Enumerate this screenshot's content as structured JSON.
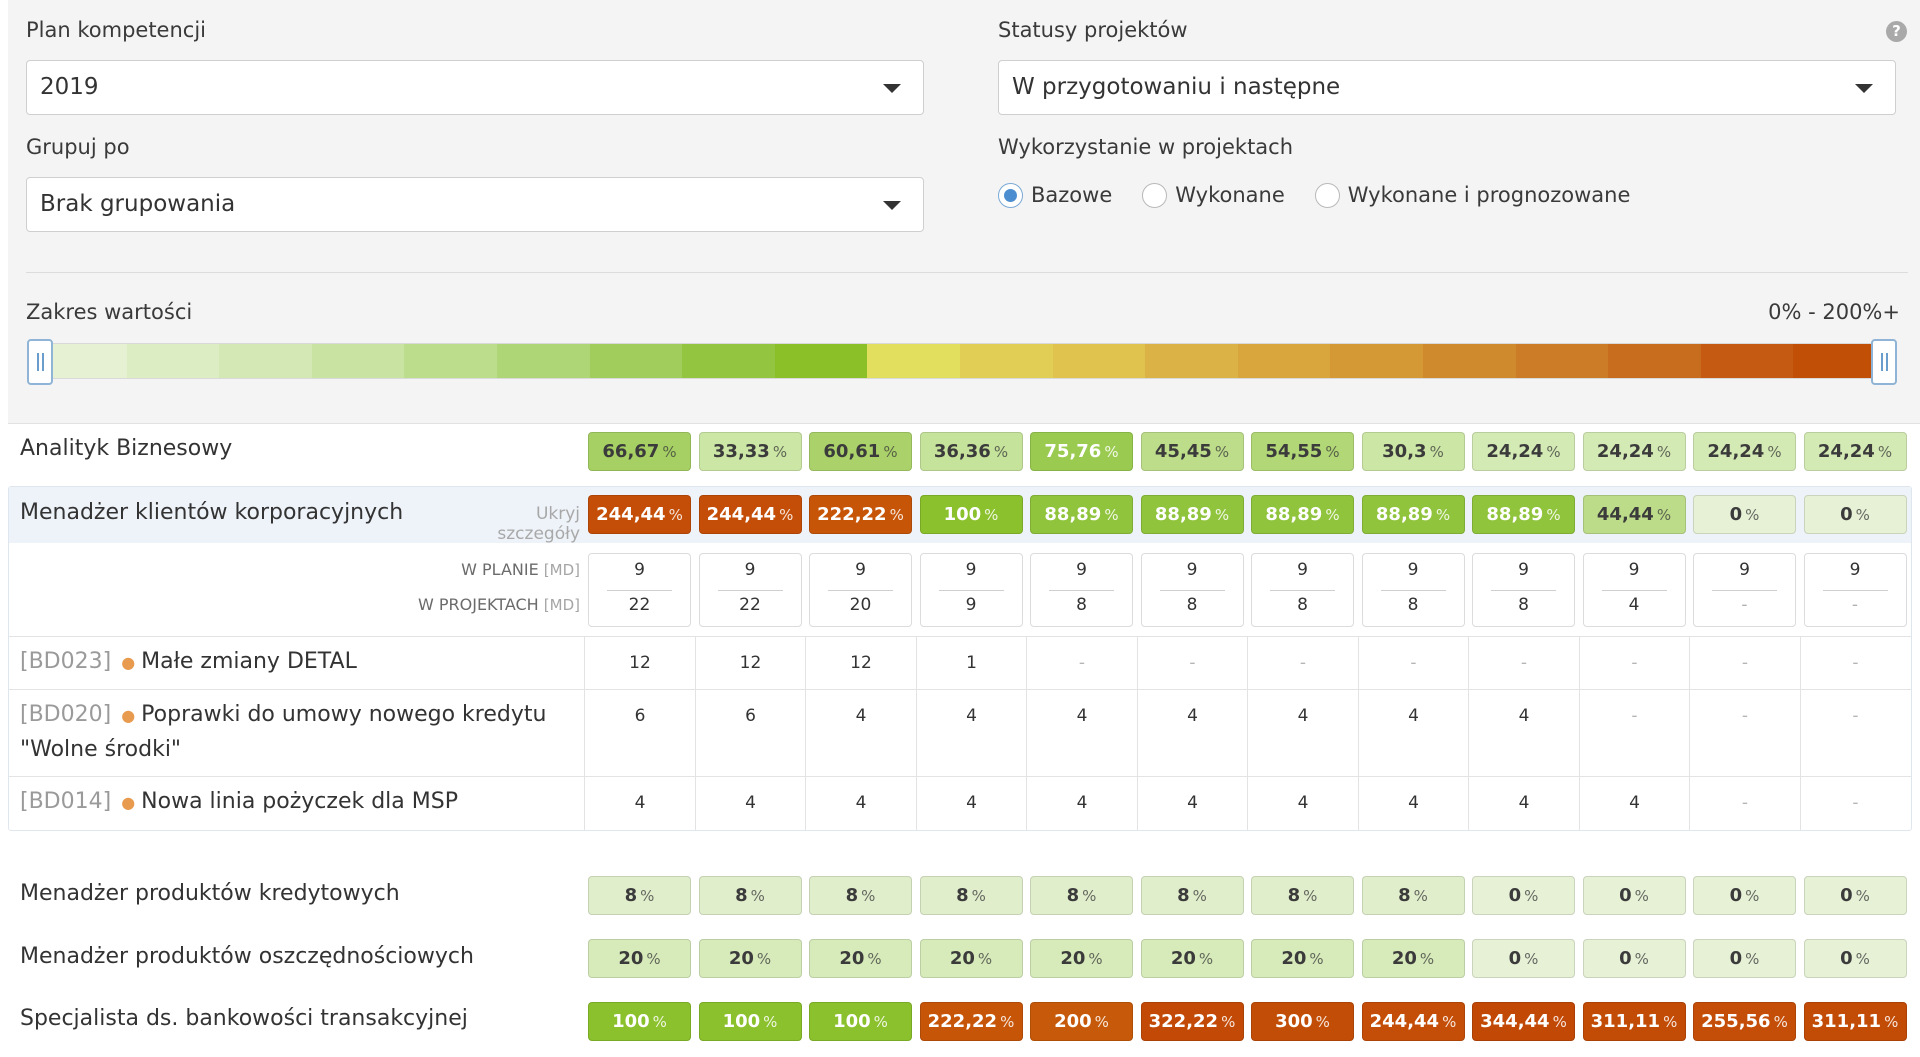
{
  "filters": {
    "plan_label": "Plan kompetencji",
    "plan_value": "2019",
    "status_label": "Statusy projektów",
    "status_value": "W przygotowaniu i następne",
    "group_label": "Grupuj po",
    "group_value": "Brak grupowania",
    "usage_label": "Wykorzystanie w projektach",
    "usage_options": [
      "Bazowe",
      "Wykonane",
      "Wykonane i prognozowane"
    ],
    "usage_selected": "Bazowe",
    "help_glyph": "?"
  },
  "range": {
    "label": "Zakres wartości",
    "value": "0% - 200%+",
    "gradient_colors": [
      "#e6f1d4",
      "#dcecc3",
      "#d4e8b5",
      "#c9e3a2",
      "#bcdd8c",
      "#aed576",
      "#a0cd5c",
      "#93c540",
      "#8bc029",
      "#e2df5e",
      "#e1ce54",
      "#e0c24e",
      "#dbb245",
      "#d8a63d",
      "#d49935",
      "#d08a2e",
      "#cc7c26",
      "#c86c1d",
      "#c55b12",
      "#c24f06"
    ]
  },
  "table": {
    "pct_unit": "%",
    "hide_details": "Ukryj szczegóły",
    "in_plan_label": "W PLANIE",
    "in_projects_label": "W PROJEKTACH",
    "md_unit": "[MD]",
    "empty": "-",
    "rows": [
      {
        "name": "Analityk Biznesowy",
        "values": [
          "66,67",
          "33,33",
          "60,61",
          "36,36",
          "75,76",
          "45,45",
          "54,55",
          "30,3",
          "24,24",
          "24,24",
          "24,24",
          "24,24"
        ],
        "colors": [
          "#a6d064",
          "#cce6a5",
          "#abd26a",
          "#c6e39b",
          "#9acb50",
          "#bddd8b",
          "#b2d776",
          "#cce6a5",
          "#d4eab4",
          "#d4eab4",
          "#d4eab4",
          "#d4eab4"
        ]
      },
      {
        "name": "Menadżer klientów korporacyjnych",
        "values": [
          "244,44",
          "244,44",
          "222,22",
          "100",
          "88,89",
          "88,89",
          "88,89",
          "88,89",
          "88,89",
          "44,44",
          "0",
          "0"
        ],
        "colors": [
          "#c44e08",
          "#c44e08",
          "#c65508",
          "#8bc12c",
          "#90c43c",
          "#90c43c",
          "#90c43c",
          "#90c43c",
          "#90c43c",
          "#bcdc8a",
          "#e6f1d6",
          "#e6f1d6"
        ],
        "in_plan": [
          "9",
          "9",
          "9",
          "9",
          "9",
          "9",
          "9",
          "9",
          "9",
          "9",
          "9",
          "9"
        ],
        "in_projects": [
          "22",
          "22",
          "20",
          "9",
          "8",
          "8",
          "8",
          "8",
          "8",
          "4",
          "-",
          "-"
        ],
        "projects": [
          {
            "code": "[BD023]",
            "name": "Małe zmiany DETAL",
            "values": [
              "12",
              "12",
              "12",
              "1",
              "-",
              "-",
              "-",
              "-",
              "-",
              "-",
              "-",
              "-"
            ]
          },
          {
            "code": "[BD020]",
            "name": "Poprawki do umowy nowego kredytu \"Wolne środki\"",
            "values": [
              "6",
              "6",
              "4",
              "4",
              "4",
              "4",
              "4",
              "4",
              "4",
              "-",
              "-",
              "-"
            ]
          },
          {
            "code": "[BD014]",
            "name": "Nowa linia pożyczek dla MSP",
            "values": [
              "4",
              "4",
              "4",
              "4",
              "4",
              "4",
              "4",
              "4",
              "4",
              "4",
              "-",
              "-"
            ]
          }
        ]
      },
      {
        "name": "Menadżer produktów kredytowych",
        "values": [
          "8",
          "8",
          "8",
          "8",
          "8",
          "8",
          "8",
          "8",
          "0",
          "0",
          "0",
          "0"
        ],
        "colors": [
          "#e1eecc",
          "#e1eecc",
          "#e1eecc",
          "#e1eecc",
          "#e1eecc",
          "#e1eecc",
          "#e1eecc",
          "#e1eecc",
          "#e6f1d6",
          "#e6f1d6",
          "#e6f1d6",
          "#e6f1d6"
        ]
      },
      {
        "name": "Menadżer produktów oszczędnościowych",
        "values": [
          "20",
          "20",
          "20",
          "20",
          "20",
          "20",
          "20",
          "20",
          "0",
          "0",
          "0",
          "0"
        ],
        "colors": [
          "#d7ebba",
          "#d7ebba",
          "#d7ebba",
          "#d7ebba",
          "#d7ebba",
          "#d7ebba",
          "#d7ebba",
          "#d7ebba",
          "#e6f1d6",
          "#e6f1d6",
          "#e6f1d6",
          "#e6f1d6"
        ]
      },
      {
        "name": "Specjalista ds. bankowości transakcyjnej",
        "values": [
          "100",
          "100",
          "100",
          "222,22",
          "200",
          "322,22",
          "300",
          "244,44",
          "344,44",
          "311,11",
          "255,56",
          "311,11"
        ],
        "colors": [
          "#8bc12c",
          "#8bc12c",
          "#8bc12c",
          "#c65508",
          "#c65a0a",
          "#c24a06",
          "#c24d06",
          "#c44e08",
          "#c24806",
          "#c24b06",
          "#c44e08",
          "#c24b06"
        ]
      }
    ]
  }
}
